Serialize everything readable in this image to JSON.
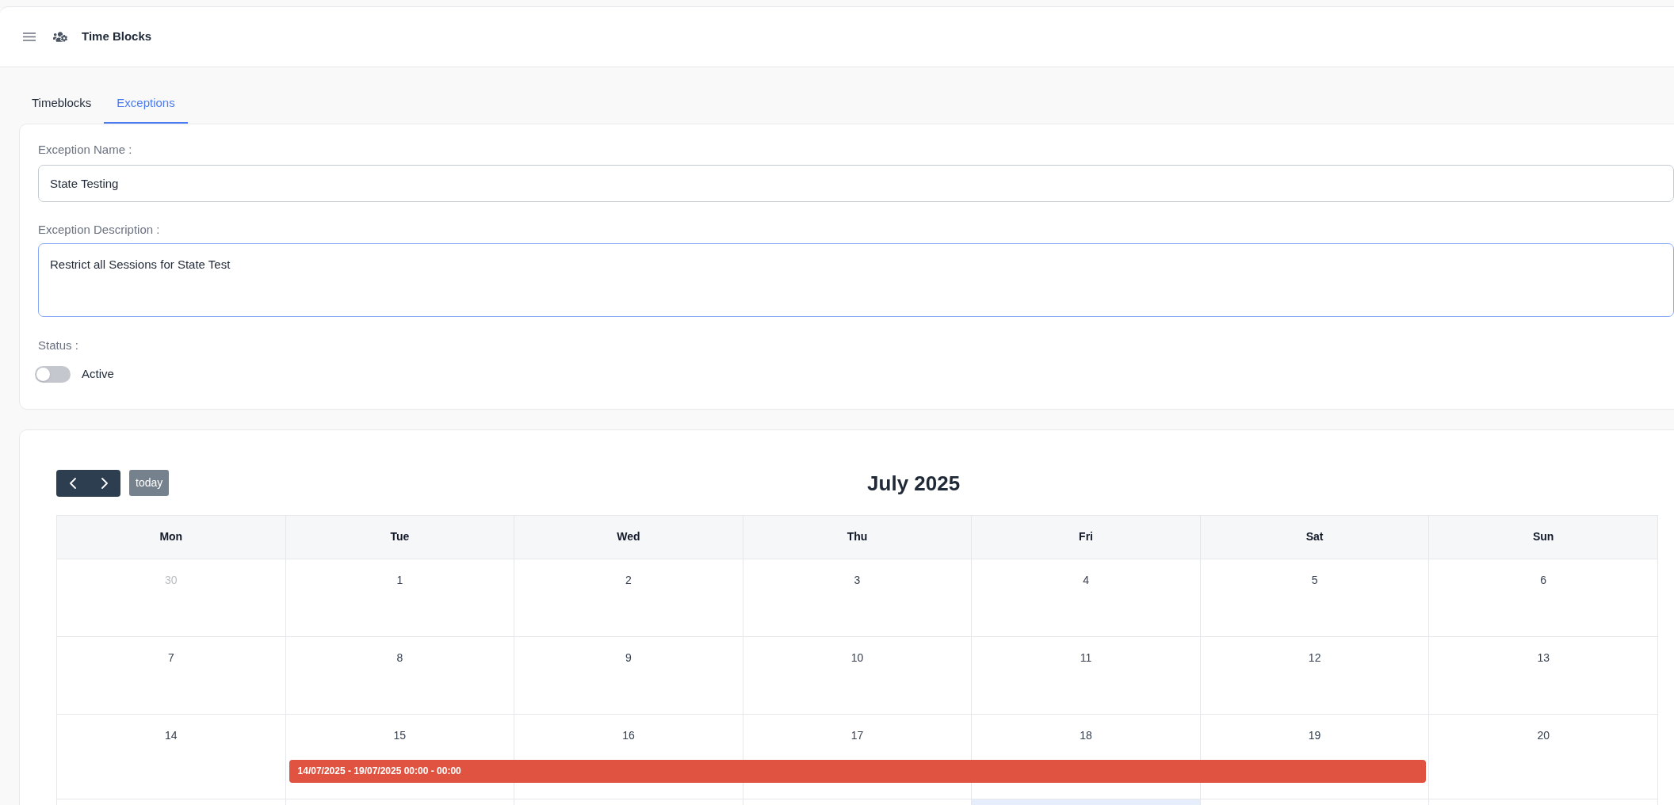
{
  "header": {
    "title": "Time Blocks"
  },
  "tabs": [
    {
      "label": "Timeblocks",
      "selected": false
    },
    {
      "label": "Exceptions",
      "selected": true
    }
  ],
  "form": {
    "name_field": {
      "label": "Exception Name :",
      "value": "State Testing",
      "focused": false
    },
    "description_field": {
      "label": "Exception Description :",
      "value": "Restrict all Sessions for State Test",
      "focused": true
    },
    "status": {
      "label": "Status :",
      "toggle_label": "Active",
      "on": false
    }
  },
  "calendar": {
    "title": "July 2025",
    "today_button": {
      "label": "today",
      "disabled": true
    },
    "weekdays": [
      "Mon",
      "Tue",
      "Wed",
      "Thu",
      "Fri",
      "Sat",
      "Sun"
    ],
    "weeks": [
      {
        "days": [
          {
            "kind": "day",
            "date": "30",
            "other_month": true,
            "today": false
          },
          {
            "kind": "day",
            "date": "1",
            "other_month": false,
            "today": false
          },
          {
            "kind": "day",
            "date": "2",
            "other_month": false,
            "today": false
          },
          {
            "kind": "day",
            "date": "3",
            "other_month": false,
            "today": false
          },
          {
            "kind": "day",
            "date": "4",
            "other_month": false,
            "today": false
          },
          {
            "kind": "day",
            "date": "5",
            "other_month": false,
            "today": false
          },
          {
            "kind": "day",
            "date": "6",
            "other_month": false,
            "today": false
          }
        ]
      },
      {
        "days": [
          {
            "kind": "day",
            "date": "7",
            "other_month": false,
            "today": false
          },
          {
            "kind": "day",
            "date": "8",
            "other_month": false,
            "today": false
          },
          {
            "kind": "day",
            "date": "9",
            "other_month": false,
            "today": false
          },
          {
            "kind": "day",
            "date": "10",
            "other_month": false,
            "today": false
          },
          {
            "kind": "day",
            "date": "11",
            "other_month": false,
            "today": false
          },
          {
            "kind": "day",
            "date": "12",
            "other_month": false,
            "today": false
          },
          {
            "kind": "day",
            "date": "13",
            "other_month": false,
            "today": false
          }
        ]
      },
      {
        "days": [
          {
            "kind": "day",
            "date": "14",
            "other_month": false,
            "today": false
          },
          {
            "kind": "event_span",
            "event": {
              "label": "14/07/2025 - 19/07/2025 00:00 - 00:00",
              "color": "#e05341"
            },
            "days": [
              {
                "kind": "day",
                "date": "15",
                "other_month": false,
                "today": false
              },
              {
                "kind": "day",
                "date": "16",
                "other_month": false,
                "today": false
              },
              {
                "kind": "day",
                "date": "17",
                "other_month": false,
                "today": false
              },
              {
                "kind": "day",
                "date": "18",
                "other_month": false,
                "today": false
              },
              {
                "kind": "day",
                "date": "19",
                "other_month": false,
                "today": false
              }
            ]
          },
          {
            "kind": "day",
            "date": "20",
            "other_month": false,
            "today": false
          }
        ]
      },
      {
        "days": [
          {
            "kind": "day",
            "today": false
          },
          {
            "kind": "day",
            "today": false
          },
          {
            "kind": "day",
            "today": false
          },
          {
            "kind": "day",
            "today": false
          },
          {
            "kind": "day",
            "today": true
          },
          {
            "kind": "day",
            "today": false
          },
          {
            "kind": "day",
            "today": false
          }
        ]
      }
    ]
  }
}
